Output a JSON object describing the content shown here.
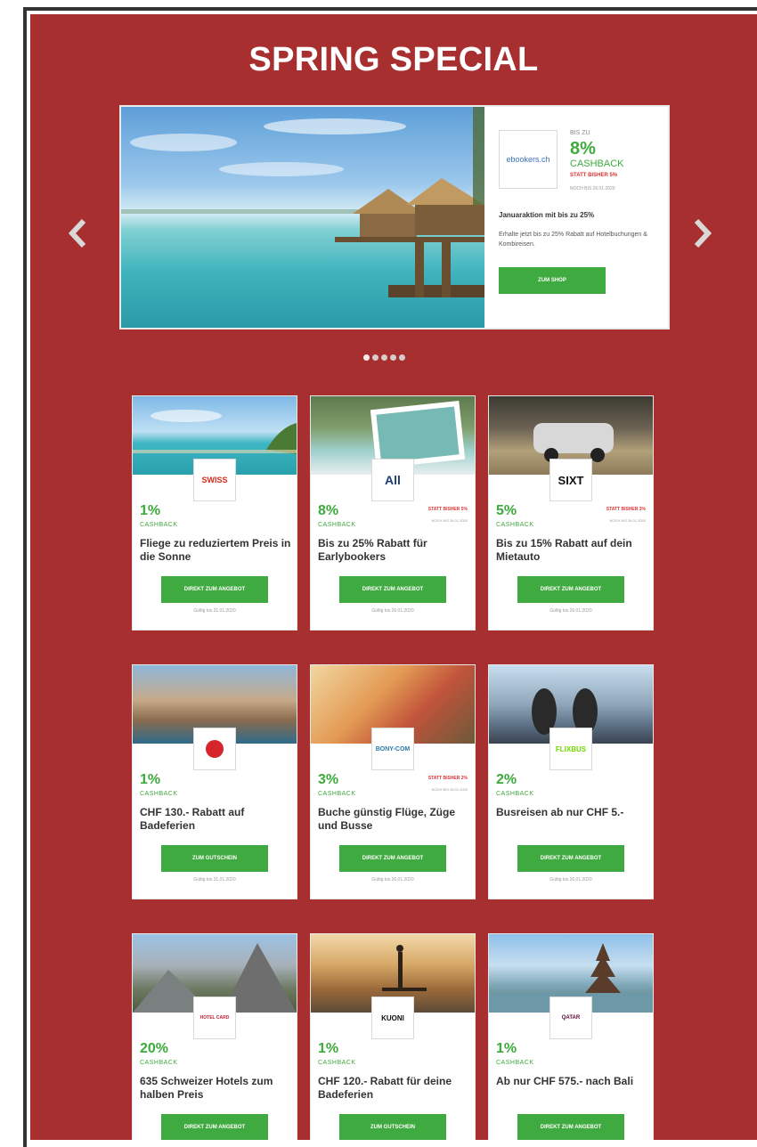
{
  "headline": "SPRING SPECIAL",
  "hero": {
    "logo": "ebookers.ch",
    "up_to": "BIS ZU",
    "cashback_pct": "8%",
    "cashback_label": "CASHBACK",
    "statt": "STATT BISHER 5%",
    "valid": "NOCH BIS 26.01.2020",
    "title": "Januaraktion mit bis zu 25%",
    "description": "Erhalte jetzt bis zu 25% Rabatt auf Hotelbuchungen & Kombireisen.",
    "button": "ZUM SHOP"
  },
  "slider_dots": 5,
  "cards": [
    {
      "logo": "SWISS",
      "pct": "1%",
      "cb": "CASHBACK",
      "title": "Fliege zu reduziertem Preis in die Sonne",
      "button": "DIREKT ZUM ANGEBOT",
      "valid": "Gültig bis 31.01.2020",
      "statt": "",
      "statt_val": ""
    },
    {
      "logo": "All",
      "pct": "8%",
      "cb": "CASHBACK",
      "title": "Bis zu 25% Rabatt für Earlybookers",
      "button": "DIREKT ZUM ANGEBOT",
      "valid": "Gültig bis 26.01.2020",
      "statt": "STATT BISHER 5%",
      "statt_val": "NOCH BIS 26.01.2020"
    },
    {
      "logo": "SIXT",
      "pct": "5%",
      "cb": "CASHBACK",
      "title": "Bis zu 15% Rabatt auf dein Mietauto",
      "button": "DIREKT ZUM ANGEBOT",
      "valid": "Gültig bis 26.01.2020",
      "statt": "STATT BISHER 3%",
      "statt_val": "NOCH BIS 26.01.2020"
    },
    {
      "logo": "",
      "pct": "1%",
      "cb": "CASHBACK",
      "title": "CHF 130.- Rabatt auf Badeferien",
      "button": "ZUM GUTSCHEIN",
      "valid": "Gültig bis 31.01.2020",
      "statt": "",
      "statt_val": ""
    },
    {
      "logo": "BONY-COM",
      "pct": "3%",
      "cb": "CASHBACK",
      "title": "Buche günstig Flüge, Züge und Busse",
      "button": "DIREKT ZUM ANGEBOT",
      "valid": "Gültig bis 26.01.2020",
      "statt": "STATT BISHER 2%",
      "statt_val": "NOCH BIS 26.01.2020"
    },
    {
      "logo": "FLIXBUS",
      "pct": "2%",
      "cb": "CASHBACK",
      "title": "Busreisen ab nur CHF 5.-",
      "button": "DIREKT ZUM ANGEBOT",
      "valid": "Gültig bis 26.01.2020",
      "statt": "",
      "statt_val": ""
    },
    {
      "logo": "HOTEL CARD",
      "pct": "20%",
      "cb": "CASHBACK",
      "title": "635 Schweizer Hotels zum halben Preis",
      "button": "DIREKT ZUM ANGEBOT",
      "valid": "",
      "statt": "",
      "statt_val": ""
    },
    {
      "logo": "KUONI",
      "pct": "1%",
      "cb": "CASHBACK",
      "title": "CHF 120.- Rabatt für deine Badeferien",
      "button": "ZUM GUTSCHEIN",
      "valid": "",
      "statt": "",
      "statt_val": ""
    },
    {
      "logo": "QATAR",
      "pct": "1%",
      "cb": "CASHBACK",
      "title": "Ab nur CHF 575.- nach Bali",
      "button": "DIREKT ZUM ANGEBOT",
      "valid": "",
      "statt": "",
      "statt_val": ""
    }
  ],
  "colors": {
    "page_bg": "#a72f30",
    "green": "#3faa3f",
    "red_text": "#dd3333"
  },
  "icons": {
    "prev": "chevron-left-icon",
    "next": "chevron-right-icon"
  }
}
